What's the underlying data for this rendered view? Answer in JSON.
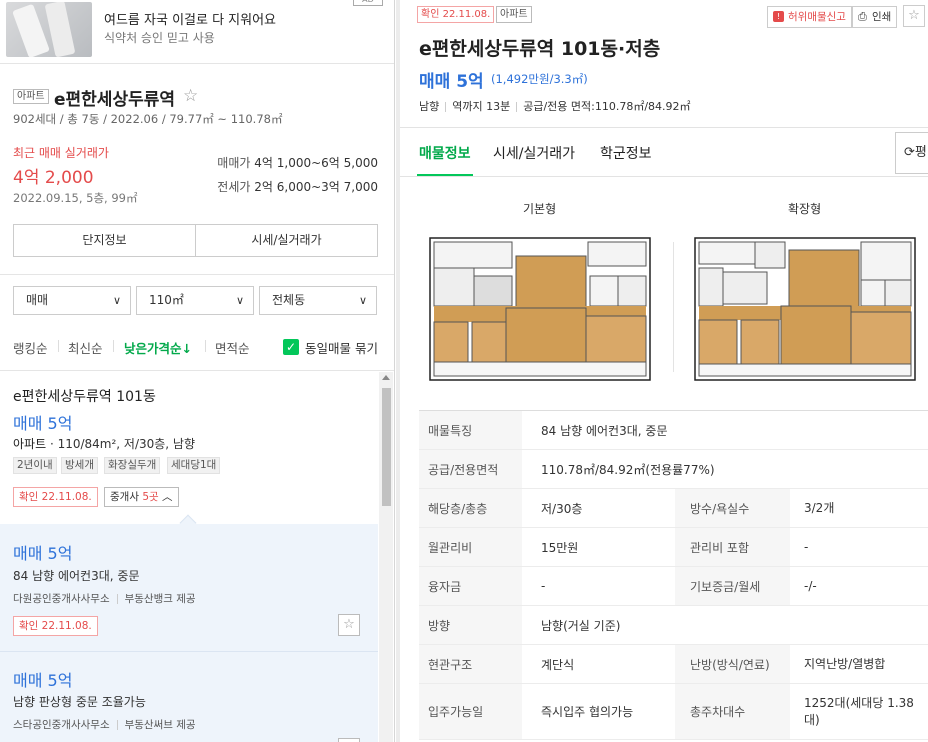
{
  "ad": {
    "title": "여드름 자국 이걸로 다 지워어요",
    "subtitle": "식약처 승인 믿고 사용",
    "tag": "AD"
  },
  "complex": {
    "type": "아파트",
    "name": "e편한세상두류역",
    "meta": "902세대 / 총 7동 / 2022.06 / 79.77㎡ ~ 110.78㎡",
    "recent_label": "최근 매매 실거래가",
    "recent_price": "4억 2,000",
    "recent_date": "2022.09.15, 5층, 99㎡",
    "sale_label": "매매가",
    "sale_range": "4억 1,000~6억 5,000",
    "jeonse_label": "전세가",
    "jeonse_range": "2억 6,000~3억 7,000",
    "btn_info": "단지정보",
    "btn_trade": "시세/실거래가"
  },
  "filters": {
    "trade": "매매",
    "area": "110㎡",
    "dong": "전체동"
  },
  "sort": {
    "ranking": "랭킹순",
    "latest": "최신순",
    "low_price": "낮은가격순↓",
    "area": "면적순",
    "group_same": "동일매물 묶기"
  },
  "listings": {
    "first": {
      "title": "e편한세상두류역 101동",
      "price": "매매 5억",
      "spec_type": "아파트",
      "spec_rest": " · 110/84m², 저/30층, 남향",
      "chips": [
        "2년이내",
        "방세개",
        "화장실두개",
        "세대당1대"
      ],
      "confirm": "확인 22.11.08.",
      "agent_text": "중개사 ",
      "agent_count": "5곳",
      "agent_chev": "︿"
    },
    "sub1": {
      "price": "매매 5억",
      "desc": "84 남향 에어컨3대, 중문",
      "agency": "다원공인중개사사무소",
      "provider": "부동산뱅크 제공",
      "confirm": "확인 22.11.08."
    },
    "sub2": {
      "price": "매매 5억",
      "desc": "남향 판상형 중문 조율가능",
      "agency": "스타공인중개사사무소",
      "provider": "부동산써브 제공"
    }
  },
  "detail": {
    "confirm": "확인 22.11.08.",
    "type": "아파트",
    "report_btn": "허위매물신고",
    "print_btn": "인쇄",
    "title": "e편한세상두류역 101동·저층",
    "price": "매매 5억",
    "unit_price": "(1,492만원/3.3㎡)",
    "facing": "남향",
    "station": "역까지 13분",
    "area": "공급/전용 면적:110.78㎡/84.92㎡",
    "tabs": [
      "매물정보",
      "시세/실거래가",
      "학군정보"
    ],
    "refresh_label": "평",
    "plan_basic": "기본형",
    "plan_extended": "확장형",
    "info": {
      "feature_k": "매물특징",
      "feature_v": "84 남향 에어컨3대, 중문",
      "area_k": "공급/전용면적",
      "area_v": "110.78㎡/84.92㎡(전용률77%)",
      "floor_k": "해당층/총층",
      "floor_v": "저/30층",
      "rooms_k": "방수/욕실수",
      "rooms_v": "3/2개",
      "fee_k": "월관리비",
      "fee_v": "15만원",
      "fee_incl_k": "관리비 포함",
      "fee_incl_v": "-",
      "loan_k": "융자금",
      "loan_v": "-",
      "deposit_k": "기보증금/월세",
      "deposit_v": "-/-",
      "dir_k": "방향",
      "dir_v": "남향(거실 기준)",
      "struct_k": "현관구조",
      "struct_v": "계단식",
      "heat_k": "난방(방식/연료)",
      "heat_v": "지역난방/열병합",
      "movein_k": "입주가능일",
      "movein_v": "즉시입주 협의가능",
      "parking_k": "총주차대수",
      "parking_v": "1252대(세대당 1.38대)"
    }
  },
  "colors": {
    "accent_green": "#03c75a",
    "price_blue": "#2e72d9",
    "confirm_red": "#e44b4b"
  }
}
